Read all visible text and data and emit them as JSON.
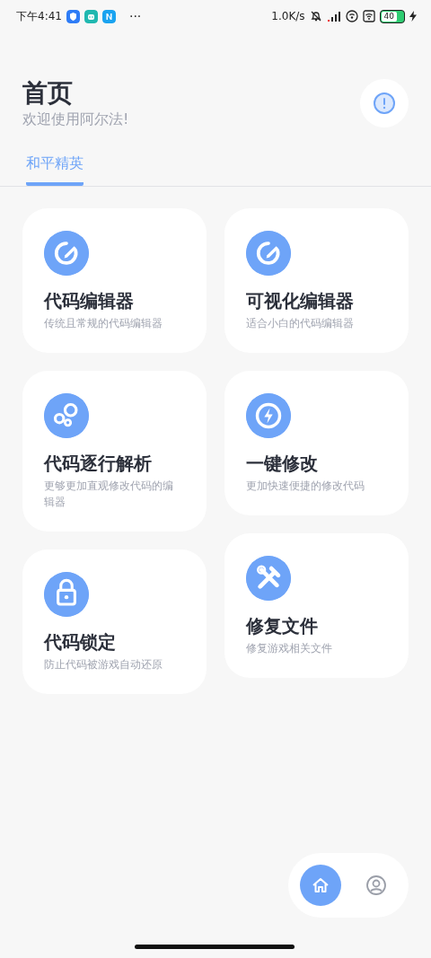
{
  "status_bar": {
    "time": "下午4:41",
    "more": "···",
    "speed": "1.0K/s",
    "battery": "40"
  },
  "header": {
    "title": "首页",
    "subtitle": "欢迎使用阿尔法!"
  },
  "tabs": [
    {
      "label": "和平精英",
      "selected": true
    }
  ],
  "columns": [
    [
      {
        "kind": "edit",
        "title": "代码编辑器",
        "subtitle": "传统且常规的代码编辑器"
      },
      {
        "kind": "bubbles",
        "title": "代码逐行解析",
        "subtitle": "更够更加直观修改代码的编辑器"
      },
      {
        "kind": "lock",
        "title": "代码锁定",
        "subtitle": "防止代码被游戏自动还原"
      }
    ],
    [
      {
        "kind": "edit",
        "title": "可视化编辑器",
        "subtitle": "适合小白的代码编辑器"
      },
      {
        "kind": "bolt",
        "title": "一键修改",
        "subtitle": "更加快速便捷的修改代码"
      },
      {
        "kind": "tools",
        "title": "修复文件",
        "subtitle": "修复游戏相关文件"
      }
    ]
  ],
  "bottom_nav": [
    {
      "kind": "home",
      "selected": true
    },
    {
      "kind": "user",
      "selected": false
    }
  ]
}
